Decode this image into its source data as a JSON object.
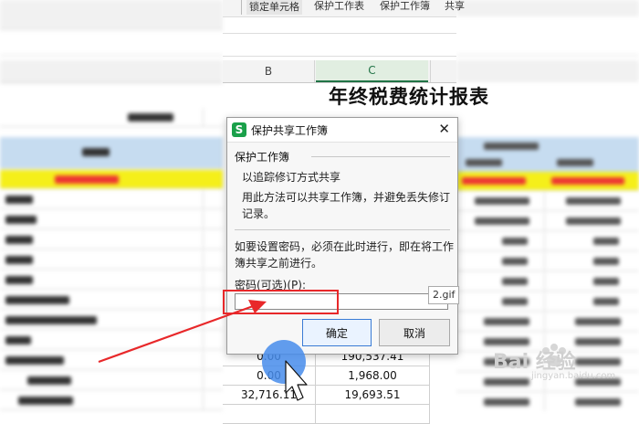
{
  "toolbar": {
    "items": [
      "锁定单元格",
      "保护工作表",
      "保护工作簿",
      "共享"
    ]
  },
  "columns": {
    "b": "B",
    "c": "C"
  },
  "sheet": {
    "title": "年终税费统计报表",
    "rows": [
      {
        "b": "0.00",
        "c": "190,537.41"
      },
      {
        "b": "0.00",
        "c": "1,968.00"
      },
      {
        "b": "32,716.11",
        "c": "19,693.51"
      }
    ]
  },
  "dialog": {
    "title": "保护共享工作簿",
    "section_label": "保护工作簿",
    "track_changes": "以追踪修订方式共享",
    "description": "用此方法可以共享工作簿，并避免丢失修订记录。",
    "note": "如要设置密码，必须在此时进行，即在将工作簿共享之前进行。",
    "password_label": "密码(可选)(P):",
    "password_value": "",
    "ok_label": "确定",
    "cancel_label": "取消",
    "close_glyph": "✕"
  },
  "overlay": {
    "gif_tag": "2.gif",
    "watermark": "Bai 经验",
    "watermark_sub": "jingyan.baidu.com"
  },
  "colors": {
    "highlight_box": "#e8282a",
    "arrow": "#e8282a",
    "click_indicator": "#468ceb",
    "active_column": "#217346"
  },
  "icons": [
    "wps-logo-icon",
    "close-icon",
    "red-arrow-icon",
    "mouse-cursor-icon"
  ]
}
